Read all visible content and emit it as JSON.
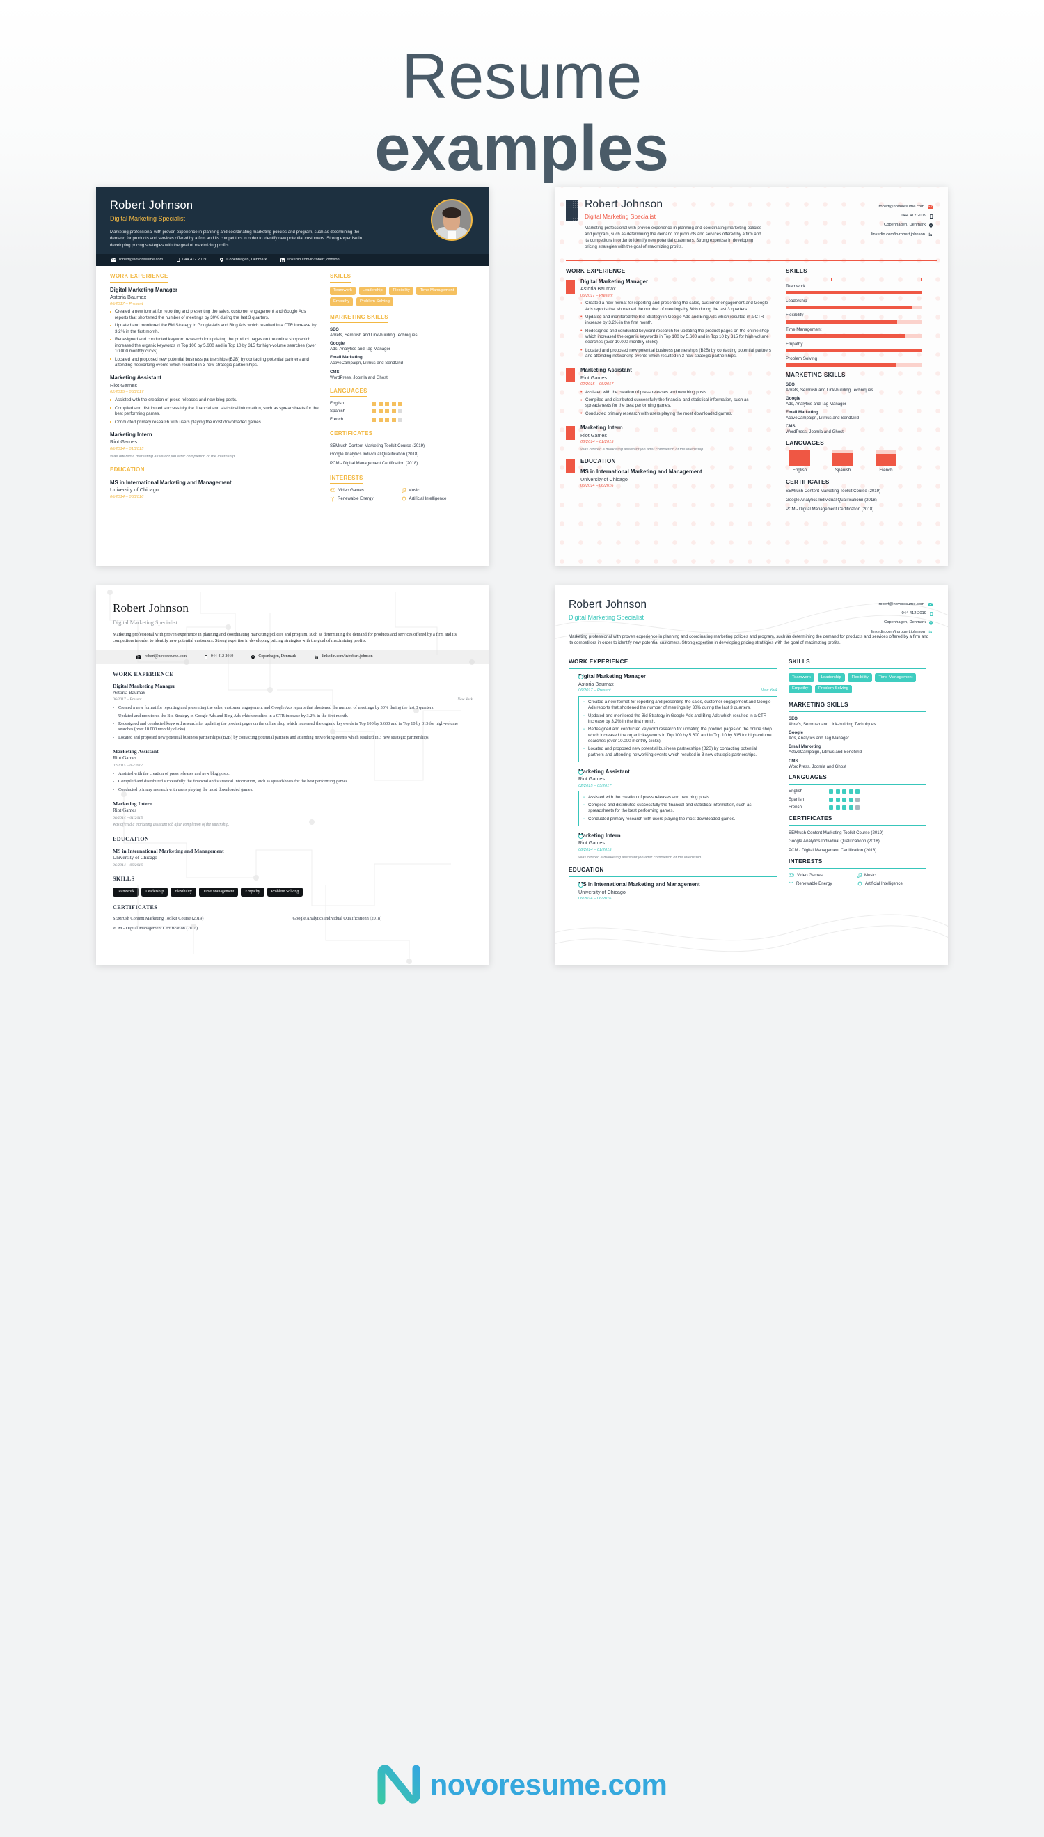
{
  "header": {
    "line1": "Resume",
    "line2": "examples"
  },
  "footer": {
    "brand": "novoresume.com",
    "logo_icon": "novoresume-n-logo"
  },
  "colors": {
    "r1_accent": "#f2b843",
    "r1_dark": "#1d3040",
    "r2_accent": "#ef5744",
    "r3_accent": "#111417",
    "r4_accent": "#38c6bb",
    "brand": "#35a8dd",
    "heading": "#4a5b68"
  },
  "person": {
    "name": "Robert Johnson",
    "title": "Digital Marketing Specialist",
    "summary": "Marketing professional with proven experience in planning and coordinating marketing policies and program, such as determining the demand for products and services offered by a firm and its competitors in order to identify new potential customers. Strong expertise in developing pricing strategies with the goal of maximizing profits.",
    "email": "robert@novoresume.com",
    "phone": "044 412 2019",
    "location": "Copenhagen, Denmark",
    "linkedin": "linkedin.com/in/robert.johnson",
    "linkedin_alt": "linkedin.com/in/robert.johnson"
  },
  "sections": {
    "work": "WORK EXPERIENCE",
    "education": "EDUCATION",
    "skills": "SKILLS",
    "marketing_skills": "MARKETING SKILLS",
    "languages": "LANGUAGES",
    "certificates": "CERTIFICATES",
    "interests": "INTERESTS"
  },
  "jobs": [
    {
      "title": "Digital Marketing Manager",
      "company": "Astoria Baumax",
      "dates": "06/2017 – Present",
      "city": "New York",
      "bullets": [
        "Created a new format for reporting and presenting the sales, customer engagement and Google Ads reports that shortened the number of meetings by 30% during the last 3 quarters.",
        "Updated and monitored the Bid Strategy in Google Ads and Bing Ads which resulted in a CTR increase by 3.2% in the first month.",
        "Redesigned and conducted keyword research for updating the product pages on the online shop which increased the organic keywords in Top 100 by 5.600 and in Top 10 by 315 for high-volume searches (over 10.000 monthly clicks).",
        "Located and proposed new potential business partnerships (B2B) by contacting potential partners and attending networking events which resulted in 3 new strategic partnerships."
      ]
    },
    {
      "title": "Marketing Assistant",
      "company": "Riot Games",
      "dates": "02/2015 – 05/2017",
      "city": "",
      "bullets": [
        "Assisted with the creation of press releases and new blog posts.",
        "Compiled and distributed successfully the financial and statistical information, such as spreadsheets for the best performing games.",
        "Conducted primary research with users playing the most downloaded games."
      ]
    },
    {
      "title": "Marketing Intern",
      "company": "Riot Games",
      "dates": "08/2014 – 01/2015",
      "city": "",
      "note": "Was offered a marketing assistant job after completion of the internship.",
      "bullets": []
    }
  ],
  "education": {
    "degree": "MS in International Marketing and Management",
    "school": "University of Chicago",
    "dates": "06/2014 – 06/2016"
  },
  "skills": [
    {
      "label": "Teamwork",
      "level": 100
    },
    {
      "label": "Leadership",
      "level": 93
    },
    {
      "label": "Flexibility",
      "level": 82
    },
    {
      "label": "Time Management",
      "level": 88
    },
    {
      "label": "Empathy",
      "level": 100
    },
    {
      "label": "Problem Solving",
      "level": 81
    }
  ],
  "marketing_skills": [
    {
      "name": "SEO",
      "detail": "Ahrefs, Semrush and Link-building Techniques"
    },
    {
      "name": "Google",
      "detail": "Ads, Analytics and Tag Manager"
    },
    {
      "name": "Email Marketing",
      "detail": "ActiveCampaign, Litmus and SendGrid"
    },
    {
      "name": "CMS",
      "detail": "WordPress, Joomla and Ghost"
    }
  ],
  "languages": [
    {
      "name": "English",
      "filled": 5,
      "total": 5,
      "pct": 100
    },
    {
      "name": "Spanish",
      "filled": 4,
      "total": 5,
      "pct": 82
    },
    {
      "name": "French",
      "filled": 4,
      "total": 5,
      "pct": 78
    }
  ],
  "certificates_r1": [
    "SEMrush Content Marketing Toolkit Course (2019)",
    "Google Analytics Individual Qualification (2018)",
    "PCM - Digital Management Certification (2018)"
  ],
  "certificates_r2": [
    "SEMrush Content Marketing Toolkit Course (2019)",
    "Google Analytics Individual Qualificationn (2018)",
    "PCM - Digital Management Certification (2018)"
  ],
  "certificates_r3": [
    "SEMrush Content Marketing Toolkit Course (2019)",
    "Google Analytics Individual Qualificationn (2018)",
    "PCM - Digital Management Certification (2018)"
  ],
  "interests": [
    {
      "label": "Video Games",
      "icon": "gamepad-icon"
    },
    {
      "label": "Music",
      "icon": "music-note-icon"
    },
    {
      "label": "Renewable Energy",
      "icon": "wind-turbine-icon"
    },
    {
      "label": "Artificial Intelligence",
      "icon": "chip-icon"
    }
  ],
  "icons": {
    "email": "envelope-icon",
    "phone": "phone-icon",
    "location": "map-pin-icon",
    "linkedin": "linkedin-icon"
  }
}
